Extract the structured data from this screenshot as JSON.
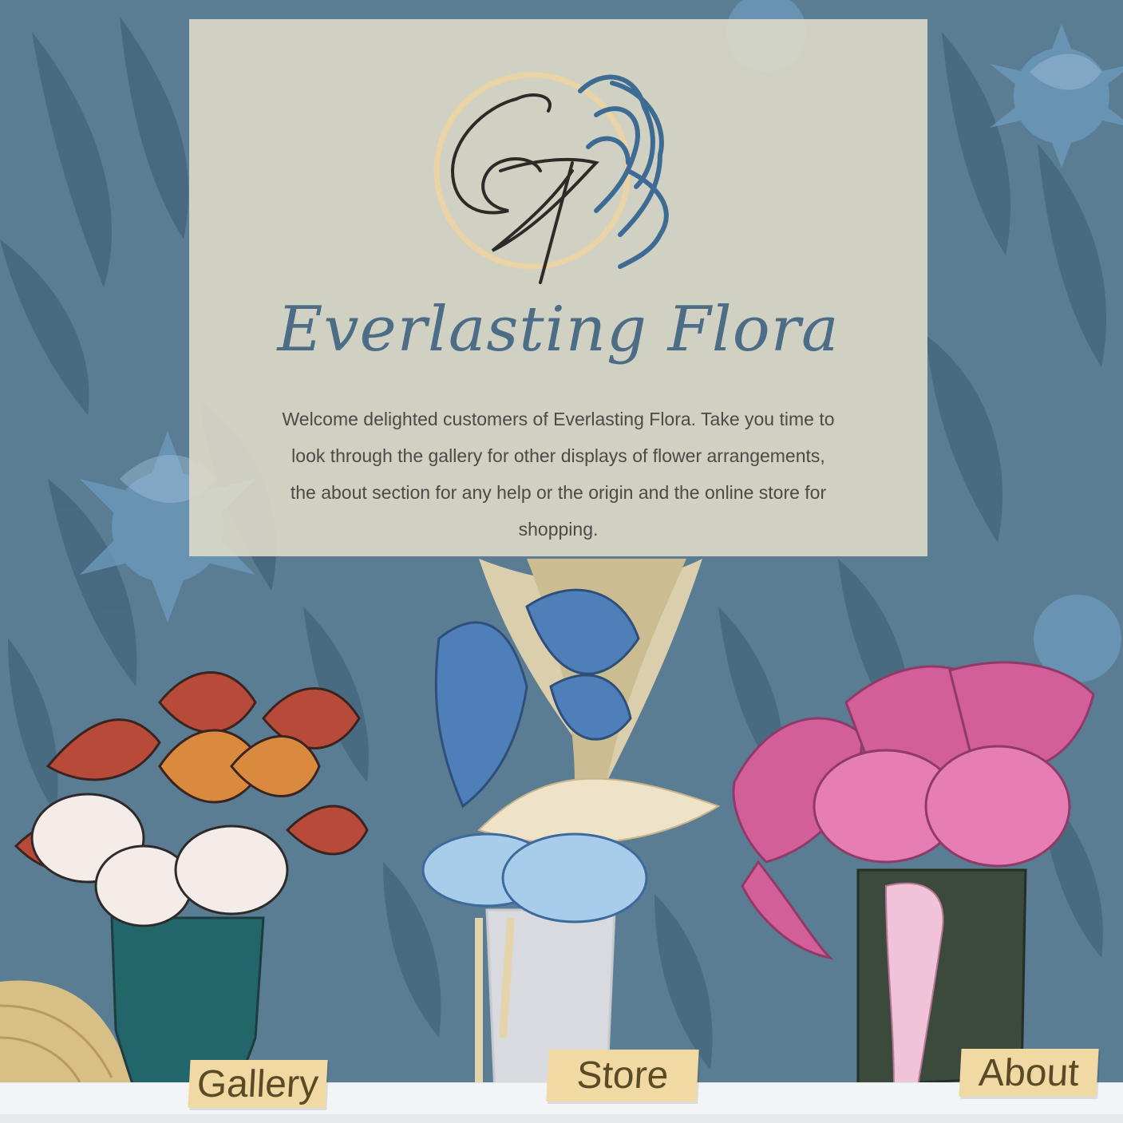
{
  "brand": {
    "monogram": "EF",
    "title": "Everlasting Flora"
  },
  "intro": {
    "text": "Welcome delighted customers of Everlasting Flora. Take you time to look through the gallery for other displays of flower arrangements, the about section for any help or the origin and the online store for shopping."
  },
  "nav": {
    "gallery_label": "Gallery",
    "store_label": "Store",
    "about_label": "About"
  },
  "colors": {
    "background": "#5a7d93",
    "card": "#dddac9",
    "title": "#4d6d86",
    "tag": "#f1d9a4",
    "tag_text": "#5b4a26"
  },
  "icons": {
    "logo": "ef-monogram-icon"
  }
}
